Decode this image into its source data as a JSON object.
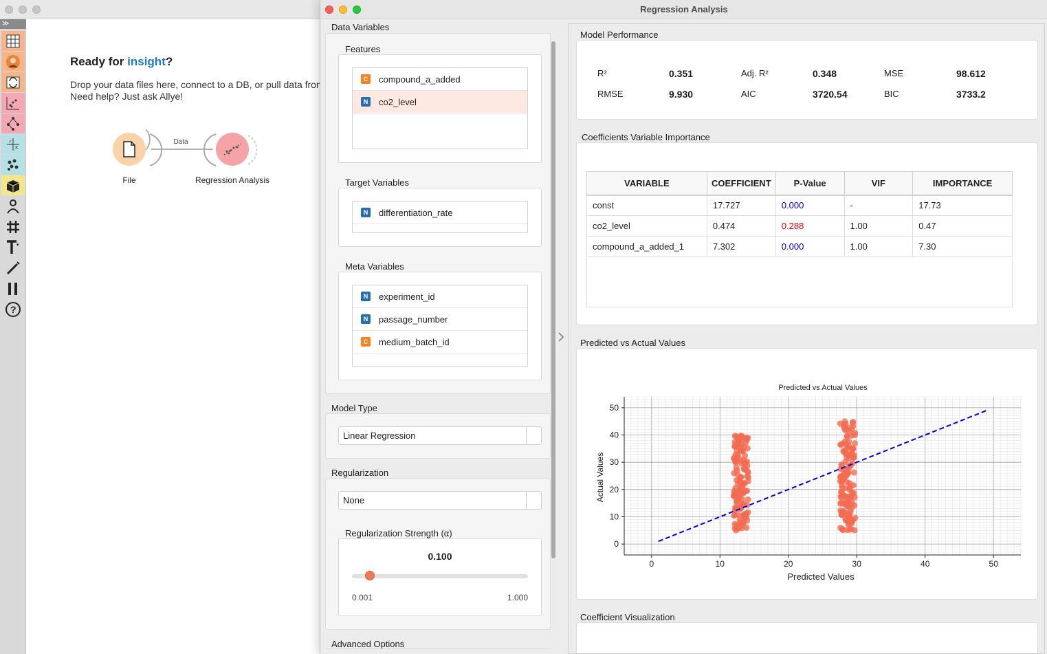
{
  "welcome": {
    "title_prefix": "Ready for ",
    "title_accent": "insight",
    "title_suffix": "?",
    "line1": "Drop your data files here, connect to a DB, or pull data from",
    "line2": "Need help? Just ask Allye!"
  },
  "workflow": {
    "file_label": "File",
    "link_label": "Data",
    "regression_label": "Regression Analysis"
  },
  "dialog": {
    "title": "Regression Analysis"
  },
  "left": {
    "data_variables_label": "Data Variables",
    "features_label": "Features",
    "features": [
      {
        "badge": "C",
        "name": "compound_a_added"
      },
      {
        "badge": "N",
        "name": "co2_level"
      }
    ],
    "target_label": "Target Variables",
    "targets": [
      {
        "badge": "N",
        "name": "differentiation_rate"
      }
    ],
    "meta_label": "Meta Variables",
    "metas": [
      {
        "badge": "N",
        "name": "experiment_id"
      },
      {
        "badge": "N",
        "name": "passage_number"
      },
      {
        "badge": "C",
        "name": "medium_batch_id"
      }
    ],
    "model_type_label": "Model Type",
    "model_type_value": "Linear Regression",
    "regularization_label": "Regularization",
    "regularization_value": "None",
    "strength_label": "Regularization Strength (α)",
    "strength_value": "0.100",
    "strength_min": "0.001",
    "strength_max": "1.000",
    "strength_fraction": 0.1,
    "advanced_label": "Advanced Options"
  },
  "performance": {
    "label": "Model Performance",
    "metrics": [
      {
        "name": "R²",
        "value": "0.351"
      },
      {
        "name": "Adj. R²",
        "value": "0.348"
      },
      {
        "name": "MSE",
        "value": "98.612"
      },
      {
        "name": "RMSE",
        "value": "9.930"
      },
      {
        "name": "AIC",
        "value": "3720.54"
      },
      {
        "name": "BIC",
        "value": "3733.2"
      }
    ]
  },
  "coefficients": {
    "tabs_label": "Coefficients  Variable Importance",
    "headers": [
      "VARIABLE",
      "COEFFICIENT",
      "P-Value",
      "VIF",
      "IMPORTANCE"
    ],
    "rows": [
      {
        "variable": "const",
        "coefficient": "17.727",
        "pvalue": "0.000",
        "pcolor": "#0000d0",
        "vif": "-",
        "importance": "17.73"
      },
      {
        "variable": "co2_level",
        "coefficient": "0.474",
        "pvalue": "0.288",
        "pcolor": "#e00000",
        "vif": "1.00",
        "importance": "0.47"
      },
      {
        "variable": "compound_a_added_1",
        "coefficient": "7.302",
        "pvalue": "0.000",
        "pcolor": "#0000d0",
        "vif": "1.00",
        "importance": "7.30"
      }
    ]
  },
  "plot_section": {
    "label": "Predicted vs Actual Values"
  },
  "coef_viz": {
    "label": "Coefficient Visualization"
  },
  "colors": {
    "accent": "#1e7ac3",
    "point": "#f26b50",
    "line": "#0000dd",
    "slider_handle": "#f07857"
  },
  "chart_data": {
    "type": "scatter",
    "title": "Predicted vs Actual Values",
    "xlabel": "Predicted Values",
    "ylabel": "Actual Values",
    "xlim": [
      -4,
      54
    ],
    "ylim": [
      -4,
      54
    ],
    "xticks": [
      0,
      10,
      20,
      30,
      40,
      50
    ],
    "yticks": [
      0,
      10,
      20,
      30,
      40,
      50
    ],
    "grid": true,
    "clusters": [
      {
        "x_range": [
          12.0,
          14.2
        ],
        "y_range": [
          5,
          40
        ]
      },
      {
        "x_range": [
          27.6,
          29.8
        ],
        "y_range": [
          5,
          45
        ]
      }
    ],
    "reference_line": {
      "x": [
        1,
        49
      ],
      "y": [
        1,
        49
      ],
      "style": "dashed"
    }
  }
}
